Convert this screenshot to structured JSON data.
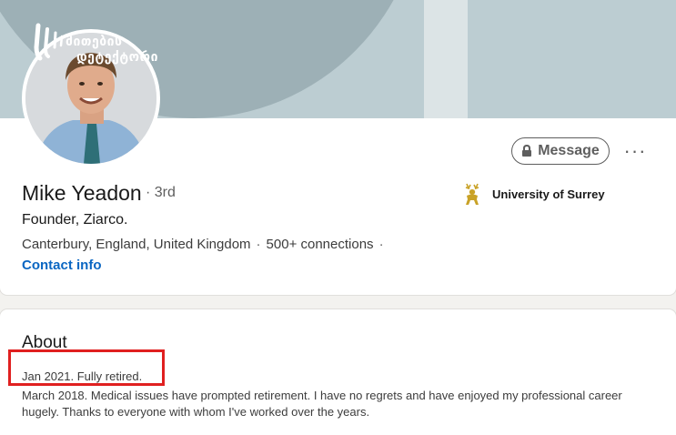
{
  "banner": {
    "watermark": [
      "მითების",
      "დეტექტორი"
    ]
  },
  "profile": {
    "name": "Mike Yeadon",
    "degree": "· 3rd",
    "headline": "Founder, Ziarco.",
    "location": "Canterbury, England, United Kingdom",
    "separator": "·",
    "connections": "500+ connections",
    "contact_info": "Contact info",
    "education": {
      "name": "University of Surrey",
      "icon": "stag-crest-icon"
    }
  },
  "actions": {
    "message_label": "Message",
    "more_label": "···"
  },
  "about": {
    "title": "About",
    "line1": "Jan 2021. Fully retired.",
    "line2": "March 2018. Medical issues have prompted retirement. I have no regrets and have enjoyed my professional career hugely. Thanks to everyone with whom I've worked over the years."
  },
  "colors": {
    "link_blue": "#0a66c2",
    "annotation_red": "#e02020",
    "banner_light": "#bccdd2",
    "banner_dark": "#9db0b6",
    "university_gold": "#c9a227"
  }
}
